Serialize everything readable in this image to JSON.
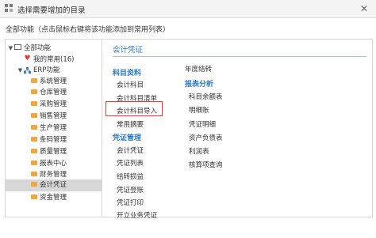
{
  "window": {
    "title": "选择需要增加的目录"
  },
  "hint": "全部功能（点击鼠标右键将该功能添加到常用列表）",
  "tree": {
    "root": "全部功能",
    "favorites": "我的常用(16)",
    "erp": "ERP功能",
    "modules": [
      "系统管理",
      "仓库管理",
      "采购管理",
      "销售管理",
      "生产管理",
      "条码管理",
      "质量管理",
      "报表中心",
      "财务管理",
      "会计凭证",
      "资金管理"
    ],
    "selected_module": "会计凭证"
  },
  "content": {
    "section_title": "会计凭证",
    "col1": {
      "cat1": "科目资料",
      "cat1_items": [
        "会计科目",
        "会计科目清单",
        "会计科目导入",
        "常用摘要"
      ],
      "cat2": "凭证管理",
      "cat2_items": [
        "会计凭证",
        "凭证列表",
        "结转损益",
        "凭证登账",
        "凭证打印",
        "开立业务凭证"
      ]
    },
    "col2": {
      "top_item": "年度结转",
      "cat": "报表分析",
      "cat_items": [
        "科目余额表",
        "明细账",
        "凭证明细",
        "资产负债表",
        "利润表",
        "核算项查询"
      ]
    },
    "highlighted_item": "会计科目导入"
  },
  "colors": {
    "accent": "#2b7bc6",
    "highlight": "#e53935",
    "folder": "#f3a63b",
    "selected_bg": "#d7d7d7"
  }
}
